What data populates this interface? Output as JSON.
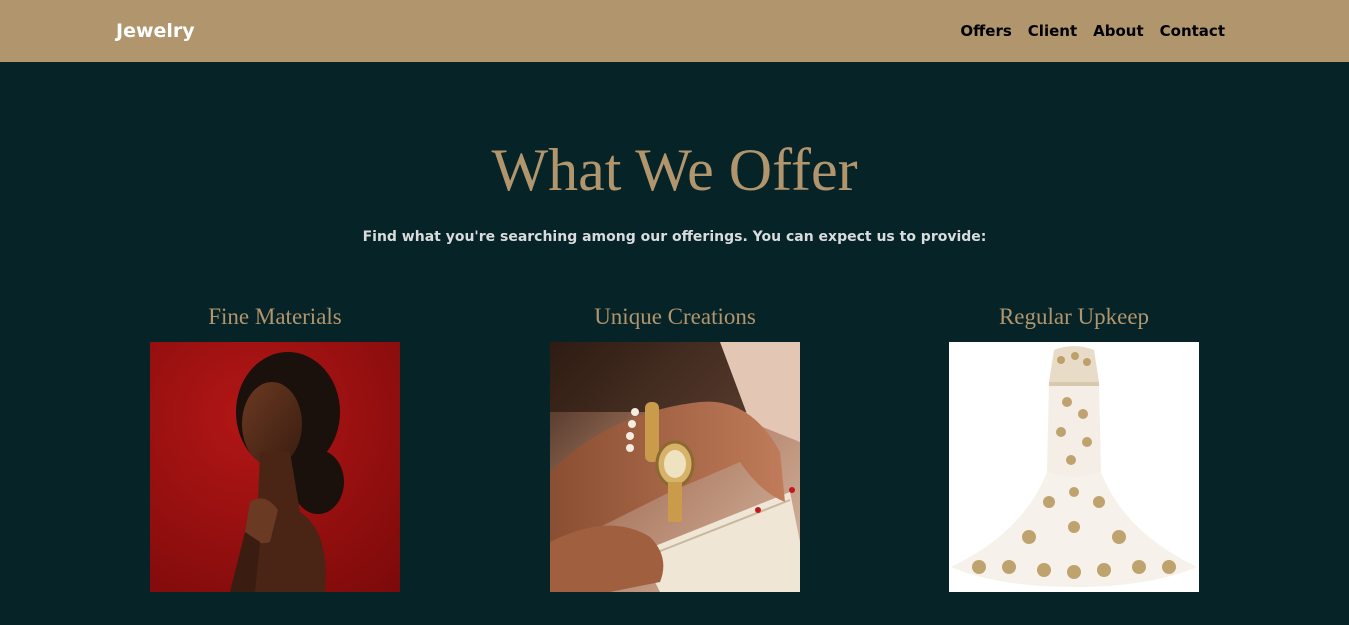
{
  "nav": {
    "brand": "Jewelry",
    "links": [
      "Offers",
      "Client",
      "About",
      "Contact"
    ]
  },
  "hero": {
    "title": "What We Offer",
    "subtitle": "Find what you're searching among our offerings. You can expect us to provide:"
  },
  "offerings": [
    {
      "title": "Fine Materials",
      "image": "woman-portrait-photo"
    },
    {
      "title": "Unique Creations",
      "image": "wrist-jewelry-photo"
    },
    {
      "title": "Regular Upkeep",
      "image": "gold-embroidered-gown-photo"
    }
  ],
  "colors": {
    "accent": "#b0956d",
    "background": "#062327",
    "nav_background": "#b0956d"
  }
}
